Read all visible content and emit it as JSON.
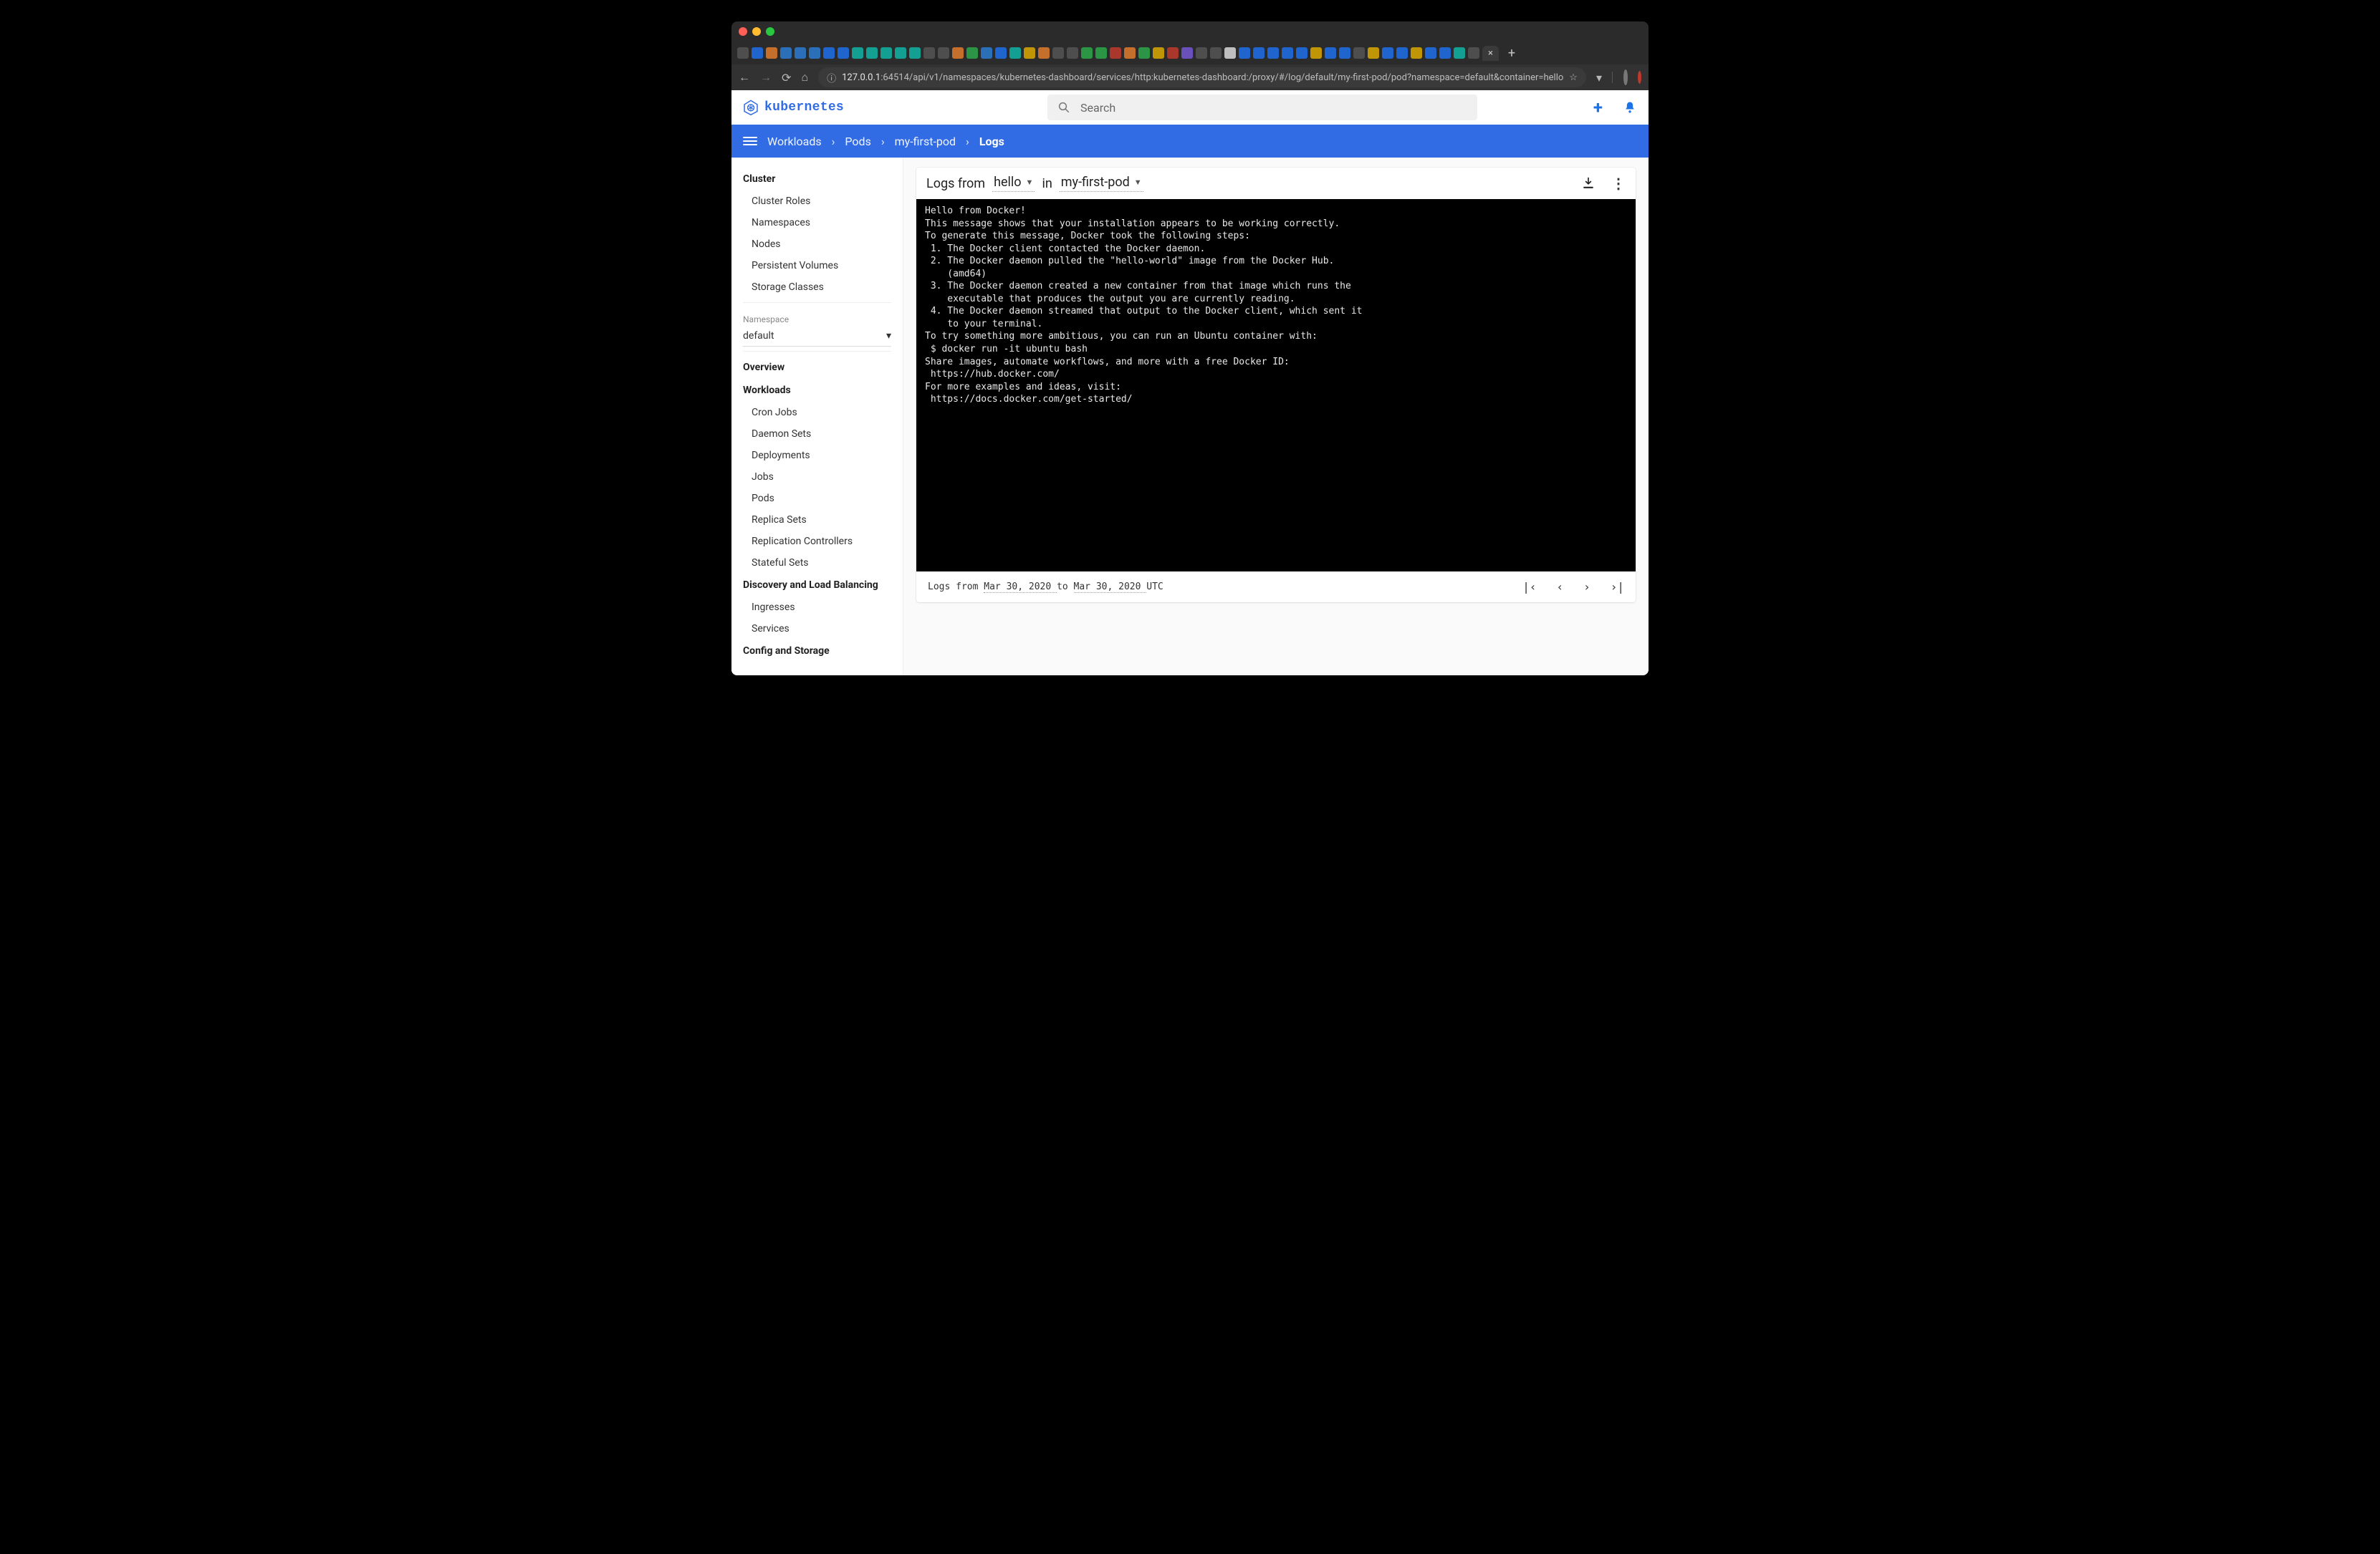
{
  "browser": {
    "url_host": "127.0.0.1",
    "url_rest": ":64514/api/v1/namespaces/kubernetes-dashboard/services/http:kubernetes-dashboard:/proxy/#/log/default/my-first-pod/pod?namespace=default&container=hello",
    "traffic_lights": {
      "close": "#ff5f57",
      "min": "#febc2e",
      "max": "#28c840"
    },
    "new_tab_glyph": "+",
    "active_tab_close": "×",
    "back_glyph": "←",
    "fwd_glyph": "→",
    "reload_glyph": "⟳",
    "home_glyph": "⌂",
    "info_glyph": "ⓘ",
    "star_glyph": "☆",
    "ext_glyph": "▾"
  },
  "header": {
    "brand": "kubernetes",
    "search_placeholder": "Search",
    "plus_glyph": "+",
    "bell_glyph": "🔔"
  },
  "breadcrumb": {
    "items": [
      "Workloads",
      "Pods",
      "my-first-pod",
      "Logs"
    ],
    "sep": "›"
  },
  "sidebar": {
    "cluster_heading": "Cluster",
    "cluster_items": [
      "Cluster Roles",
      "Namespaces",
      "Nodes",
      "Persistent Volumes",
      "Storage Classes"
    ],
    "namespace_label": "Namespace",
    "namespace_value": "default",
    "overview": "Overview",
    "workloads_heading": "Workloads",
    "workloads_items": [
      "Cron Jobs",
      "Daemon Sets",
      "Deployments",
      "Jobs",
      "Pods",
      "Replica Sets",
      "Replication Controllers",
      "Stateful Sets"
    ],
    "discovery_heading": "Discovery and Load Balancing",
    "discovery_items": [
      "Ingresses",
      "Services"
    ],
    "config_heading": "Config and Storage"
  },
  "logs": {
    "prefix": "Logs from",
    "container": "hello",
    "in_word": "in",
    "pod": "my-first-pod",
    "download_glyph": "⬇",
    "more_glyph": "⋮",
    "text": "Hello from Docker!\nThis message shows that your installation appears to be working correctly.\nTo generate this message, Docker took the following steps:\n 1. The Docker client contacted the Docker daemon.\n 2. The Docker daemon pulled the \"hello-world\" image from the Docker Hub.\n    (amd64)\n 3. The Docker daemon created a new container from that image which runs the\n    executable that produces the output you are currently reading.\n 4. The Docker daemon streamed that output to the Docker client, which sent it\n    to your terminal.\nTo try something more ambitious, you can run an Ubuntu container with:\n $ docker run -it ubuntu bash\nShare images, automate workflows, and more with a free Docker ID:\n https://hub.docker.com/\nFor more examples and ideas, visit:\n https://docs.docker.com/get-started/",
    "footer_prefix": "Logs from ",
    "from_date": "Mar 30, 2020 ",
    "to_word": "to ",
    "to_date": "Mar 30, 2020 ",
    "tz": "UTC",
    "pager": {
      "first": "|‹",
      "prev": "‹",
      "next": "›",
      "last": "›|"
    }
  }
}
